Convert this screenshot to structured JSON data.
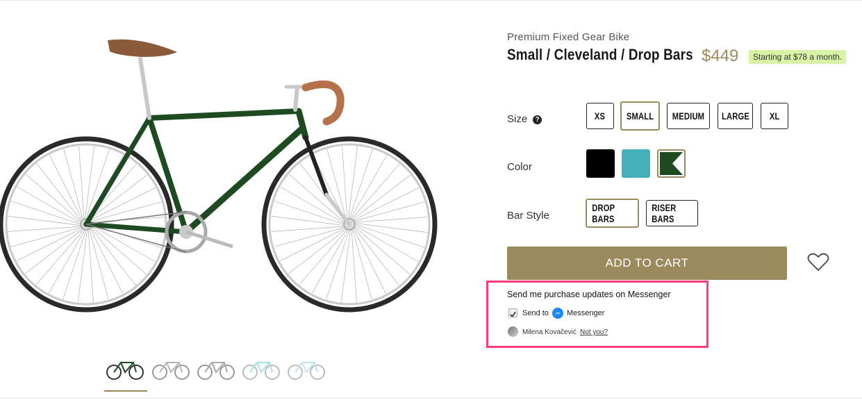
{
  "product": {
    "subtitle": "Premium Fixed Gear Bike",
    "title": "Small / Cleveland / Drop Bars",
    "price": "$449",
    "financing": "Starting at $78 a month."
  },
  "options": {
    "size": {
      "label": "Size",
      "help_icon": "question-circle-icon",
      "values": [
        "XS",
        "SMALL",
        "MEDIUM",
        "LARGE",
        "XL"
      ],
      "selected": "SMALL"
    },
    "color": {
      "label": "Color",
      "swatches": [
        {
          "name": "black",
          "color": "#000000"
        },
        {
          "name": "teal",
          "color": "#45afb8"
        },
        {
          "name": "green-white",
          "color": "#1e4a22"
        }
      ],
      "selected": "green-white"
    },
    "bar_style": {
      "label": "Bar Style",
      "values": [
        "DROP BARS",
        "RISER BARS"
      ],
      "selected": "DROP BARS"
    }
  },
  "cart": {
    "add_label": "ADD TO CART",
    "wishlist_icon": "heart-outline-icon"
  },
  "messenger": {
    "title": "Send me purchase updates on Messenger",
    "send_to": "Send to",
    "messenger_label": "Messenger",
    "checked": true,
    "user_name": "Milena Kovačević",
    "not_you": "Not you?"
  },
  "colors": {
    "accent": "#9b8a5e",
    "financing_bg": "#d8f2a6",
    "highlight_border": "#ff3b7a",
    "bike_frame": "#1e4a22"
  },
  "thumbnails": [
    {
      "name": "thumb-green",
      "color": "#1e4a22"
    },
    {
      "name": "thumb-silver-1",
      "color": "#b5b5b5"
    },
    {
      "name": "thumb-silver-2",
      "color": "#a8a8a8"
    },
    {
      "name": "thumb-light-teal",
      "color": "#a7dfe6"
    },
    {
      "name": "thumb-light-teal-2",
      "color": "#bfe5ea"
    }
  ]
}
